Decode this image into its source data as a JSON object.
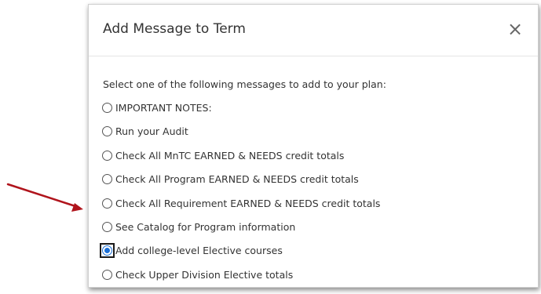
{
  "dialog": {
    "title": "Add Message to Term",
    "close_symbol": "×",
    "prompt": "Select one of the following messages to add to your plan:"
  },
  "options": [
    {
      "label": "IMPORTANT NOTES:",
      "checked": false
    },
    {
      "label": "Run your Audit",
      "checked": false
    },
    {
      "label": "Check All MnTC EARNED & NEEDS credit totals",
      "checked": false
    },
    {
      "label": "Check All Program EARNED & NEEDS credit totals",
      "checked": false
    },
    {
      "label": "Check All Requirement EARNED & NEEDS credit totals",
      "checked": false
    },
    {
      "label": "See Catalog for Program information",
      "checked": false
    },
    {
      "label": "Add college-level Elective courses",
      "checked": true
    },
    {
      "label": "Check Upper Division Elective totals",
      "checked": false
    }
  ],
  "annotation": {
    "icon": "arrow-icon",
    "color": "#b0141c"
  }
}
